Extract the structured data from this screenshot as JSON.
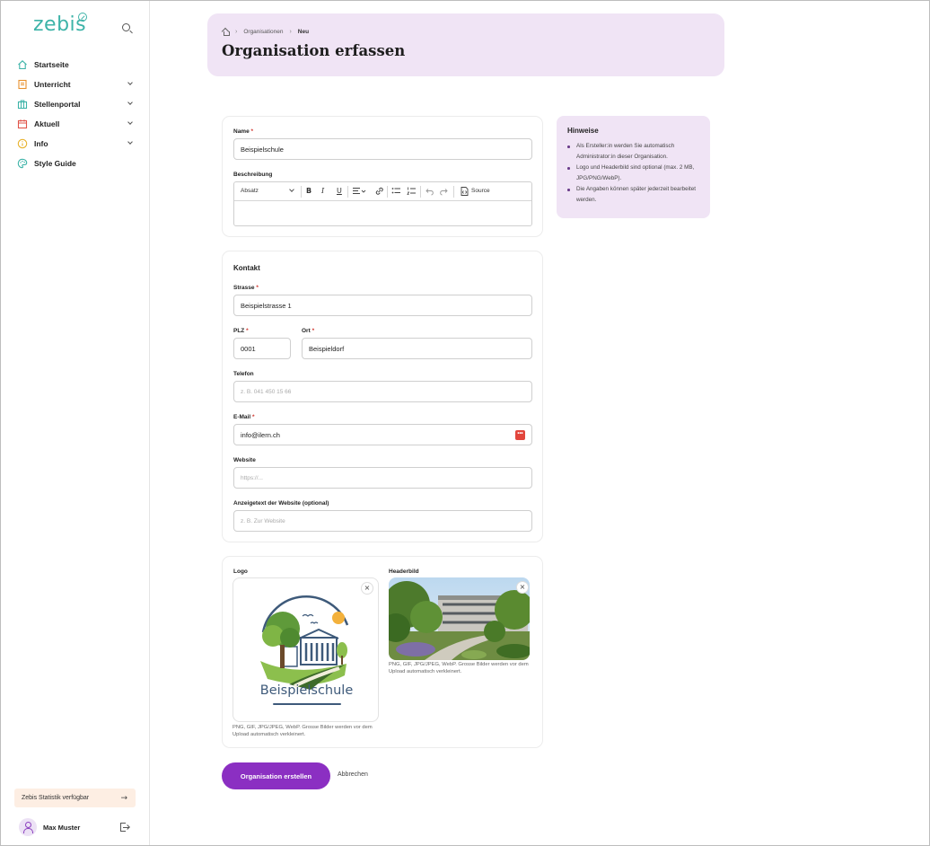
{
  "app": {
    "logo": "zebis"
  },
  "sidebar": {
    "items": [
      {
        "label": "Startseite",
        "icon": "home-icon",
        "color": "#3db3a8",
        "expandable": false
      },
      {
        "label": "Unterricht",
        "icon": "book-icon",
        "color": "#e8912d",
        "expandable": true
      },
      {
        "label": "Stellenportal",
        "icon": "briefcase-icon",
        "color": "#3db3a8",
        "expandable": true
      },
      {
        "label": "Aktuell",
        "icon": "calendar-icon",
        "color": "#e0554a",
        "expandable": true
      },
      {
        "label": "Info",
        "icon": "info-icon",
        "color": "#e8b22d",
        "expandable": true
      },
      {
        "label": "Style Guide",
        "icon": "palette-icon",
        "color": "#3db3a8",
        "expandable": false
      }
    ],
    "promo": {
      "label": "Zebis Statistik verfügbar",
      "arrow": "→"
    },
    "user": {
      "name": "Max Muster"
    }
  },
  "header": {
    "breadcrumb": [
      "Organisationen",
      "Neu"
    ],
    "title": "Organisation erfassen"
  },
  "form": {
    "name": {
      "label": "Name",
      "value": "Beispielschule"
    },
    "description": {
      "label": "Beschreibung",
      "toolbar": {
        "format": "Absatz",
        "source": "Source"
      }
    },
    "contact": {
      "title": "Kontakt",
      "street": {
        "label": "Strasse",
        "value": "Beispielstrasse 1"
      },
      "zip": {
        "label": "PLZ",
        "value": "0001"
      },
      "city": {
        "label": "Ort",
        "value": "Beispieldorf"
      },
      "phone": {
        "label": "Telefon",
        "placeholder": "z. B. 041 450 15 66"
      },
      "email": {
        "label": "E-Mail",
        "value": "info@ilern.ch"
      },
      "website": {
        "label": "Website",
        "placeholder": "https://..."
      },
      "website_text": {
        "label": "Anzeigetext der Website (optional)",
        "placeholder": "z. B. Zur Website"
      }
    },
    "media": {
      "logo": {
        "label": "Logo",
        "school_name": "Beispielschule",
        "note": "PNG, GIF, JPG/JPEG, WebP. Grosse Bilder werden vor dem Upload automatisch verkleinert."
      },
      "header": {
        "label": "Headerbild",
        "note": "PNG, GIF, JPG/JPEG, WebP. Grosse Bilder werden vor dem Upload automatisch verkleinert."
      },
      "remove_symbol": "×"
    },
    "submit_label": "Organisation erstellen",
    "cancel_label": "Abbrechen"
  },
  "hints": {
    "title": "Hinweise",
    "items": [
      "Als Ersteller:in werden Sie automatisch Administrator:in dieser Organisation.",
      "Logo und Headerbild sind optional (max. 2 MB, JPG/PNG/WebP).",
      "Die Angaben können später jederzeit bearbeitet werden."
    ]
  },
  "colors": {
    "accent": "#8b2fc2",
    "brand": "#3db3a8",
    "header_bg": "#f0e4f5",
    "required": "#d0342c"
  }
}
